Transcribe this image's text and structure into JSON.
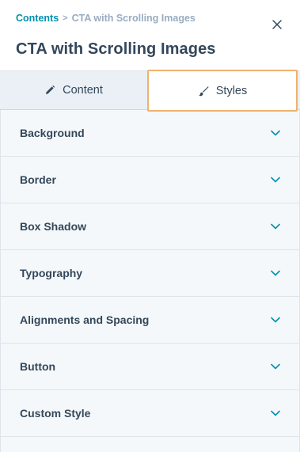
{
  "breadcrumb": {
    "parent": "Contents",
    "separator": ">",
    "current": "CTA with Scrolling Images"
  },
  "title": "CTA with Scrolling Images",
  "close_icon": "close-icon",
  "tabs": [
    {
      "label": "Content",
      "icon": "pencil-icon",
      "active": false
    },
    {
      "label": "Styles",
      "icon": "brush-icon",
      "active": true
    }
  ],
  "sections": [
    {
      "label": "Background"
    },
    {
      "label": "Border"
    },
    {
      "label": "Box Shadow"
    },
    {
      "label": "Typography"
    },
    {
      "label": "Alignments and Spacing"
    },
    {
      "label": "Button"
    },
    {
      "label": "Custom Style"
    }
  ],
  "colors": {
    "link": "#0091ae",
    "text": "#33475b",
    "muted": "#99acc2",
    "tab_bg": "#eaf0f6",
    "focus_outline": "#efb26e",
    "chevron": "#0091ae"
  }
}
